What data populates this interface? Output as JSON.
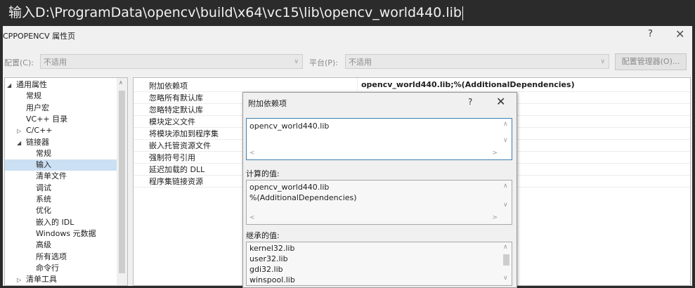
{
  "annotation": "输入D:\\ProgramData\\opencv\\build\\x64\\vc15\\lib\\opencv_world440.lib",
  "window": {
    "title": "CPPOPENCV 属性页",
    "help": "?",
    "close": "✕"
  },
  "config": {
    "config_label": "配置(C):",
    "config_value": "不适用",
    "platform_label": "平台(P):",
    "platform_value": "不适用",
    "manager_button": "配置管理器(O)..."
  },
  "tree": {
    "items": [
      {
        "label": "通用属性",
        "expander": "◢"
      },
      {
        "label": "常规"
      },
      {
        "label": "用户宏"
      },
      {
        "label": "VC++ 目录"
      },
      {
        "label": "C/C++",
        "expander": "▷"
      },
      {
        "label": "链接器",
        "expander": "◢"
      },
      {
        "label": "常规"
      },
      {
        "label": "输入",
        "selected": true
      },
      {
        "label": "清单文件"
      },
      {
        "label": "调试"
      },
      {
        "label": "系统"
      },
      {
        "label": "优化"
      },
      {
        "label": "嵌入的 IDL"
      },
      {
        "label": "Windows 元数据"
      },
      {
        "label": "高级"
      },
      {
        "label": "所有选项"
      },
      {
        "label": "命令行"
      },
      {
        "label": "清单工具",
        "expander": "▷"
      }
    ]
  },
  "properties": [
    {
      "name": "附加依赖项",
      "value": "opencv_world440.lib;%(AdditionalDependencies)"
    },
    {
      "name": "忽略所有默认库",
      "value": ""
    },
    {
      "name": "忽略特定默认库",
      "value": ""
    },
    {
      "name": "模块定义文件",
      "value": ""
    },
    {
      "name": "将模块添加到程序集",
      "value": ""
    },
    {
      "name": "嵌入托管资源文件",
      "value": ""
    },
    {
      "name": "强制符号引用",
      "value": ""
    },
    {
      "name": "延迟加载的 DLL",
      "value": ""
    },
    {
      "name": "程序集链接资源",
      "value": ""
    }
  ],
  "dialog": {
    "title": "附加依赖项",
    "help": "?",
    "close": "✕",
    "input_value": "opencv_world440.lib",
    "computed_label": "计算的值:",
    "computed_values": [
      "opencv_world440.lib",
      "%(AdditionalDependencies)"
    ],
    "inherited_label": "继承的值:",
    "inherited_values": [
      "kernel32.lib",
      "user32.lib",
      "gdi32.lib",
      "winspool.lib"
    ]
  }
}
